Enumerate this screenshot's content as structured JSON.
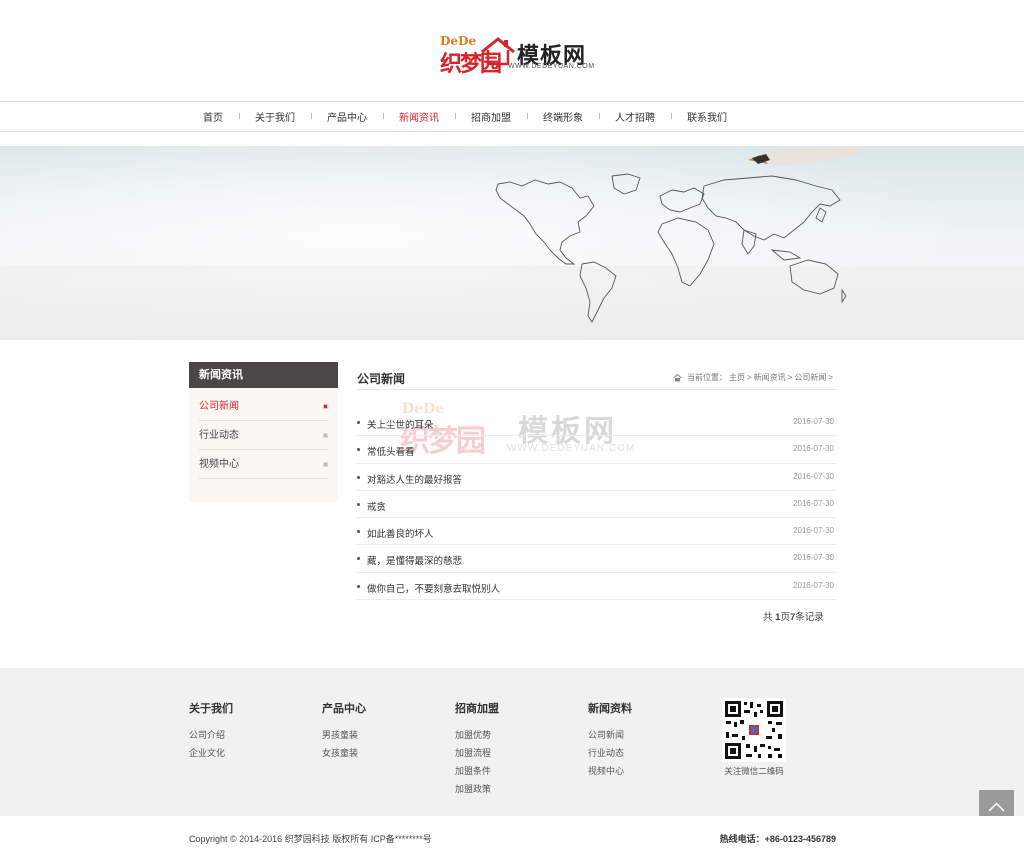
{
  "logo": {
    "dede": "DeDe",
    "zhi": "织梦园",
    "muban": "模板网",
    "url": "WWW.DEDEYUAN.COM"
  },
  "nav": [
    {
      "label": "首页"
    },
    {
      "label": "关于我们"
    },
    {
      "label": "产品中心"
    },
    {
      "label": "新闻资讯",
      "active": true
    },
    {
      "label": "招商加盟"
    },
    {
      "label": "终端形象"
    },
    {
      "label": "人才招聘"
    },
    {
      "label": "联系我们"
    }
  ],
  "sidebar": {
    "title": "新闻资讯",
    "items": [
      {
        "label": "公司新闻",
        "active": true
      },
      {
        "label": "行业动态"
      },
      {
        "label": "视频中心"
      }
    ]
  },
  "content": {
    "title": "公司新闻",
    "breadcrumb": [
      "当前位置：",
      "主页",
      ">",
      "新闻资讯",
      ">",
      "公司新闻",
      ">"
    ],
    "news": [
      {
        "title": "关上尘世的耳朵",
        "date": "2016-07-30"
      },
      {
        "title": "常低头看看",
        "date": "2016-07-30"
      },
      {
        "title": "对豁达人生的最好报答",
        "date": "2016-07-30"
      },
      {
        "title": "戒贪",
        "date": "2016-07-30"
      },
      {
        "title": "如此善良的坏人",
        "date": "2016-07-30"
      },
      {
        "title": "藏，是懂得最深的慈悲",
        "date": "2016-07-30"
      },
      {
        "title": "做你自己，不要刻意去取悦别人",
        "date": "2016-07-30"
      }
    ],
    "pager": {
      "prefix": "共 ",
      "pages": "1",
      "mid": "页",
      "records": "7",
      "suffix": "条记录"
    }
  },
  "footer": {
    "columns": [
      {
        "heading": "关于我们",
        "links": [
          "公司介绍",
          "企业文化"
        ]
      },
      {
        "heading": "产品中心",
        "links": [
          "男孩童装",
          "女孩童装"
        ]
      },
      {
        "heading": "招商加盟",
        "links": [
          "加盟优势",
          "加盟流程",
          "加盟条件",
          "加盟政策"
        ]
      },
      {
        "heading": "新闻资料",
        "links": [
          "公司新闻",
          "行业动态",
          "视频中心"
        ]
      }
    ],
    "qr_caption": "关注微信二维码",
    "copyright": "Copyright © 2014-2016 织梦园科技 版权所有  ICP备********号",
    "hotline": "热线电话：+86-0123-456789"
  },
  "colors": {
    "accent": "#d8232a",
    "sidebar_header": "#4b4643",
    "footer_bg": "#f1f1f1"
  }
}
